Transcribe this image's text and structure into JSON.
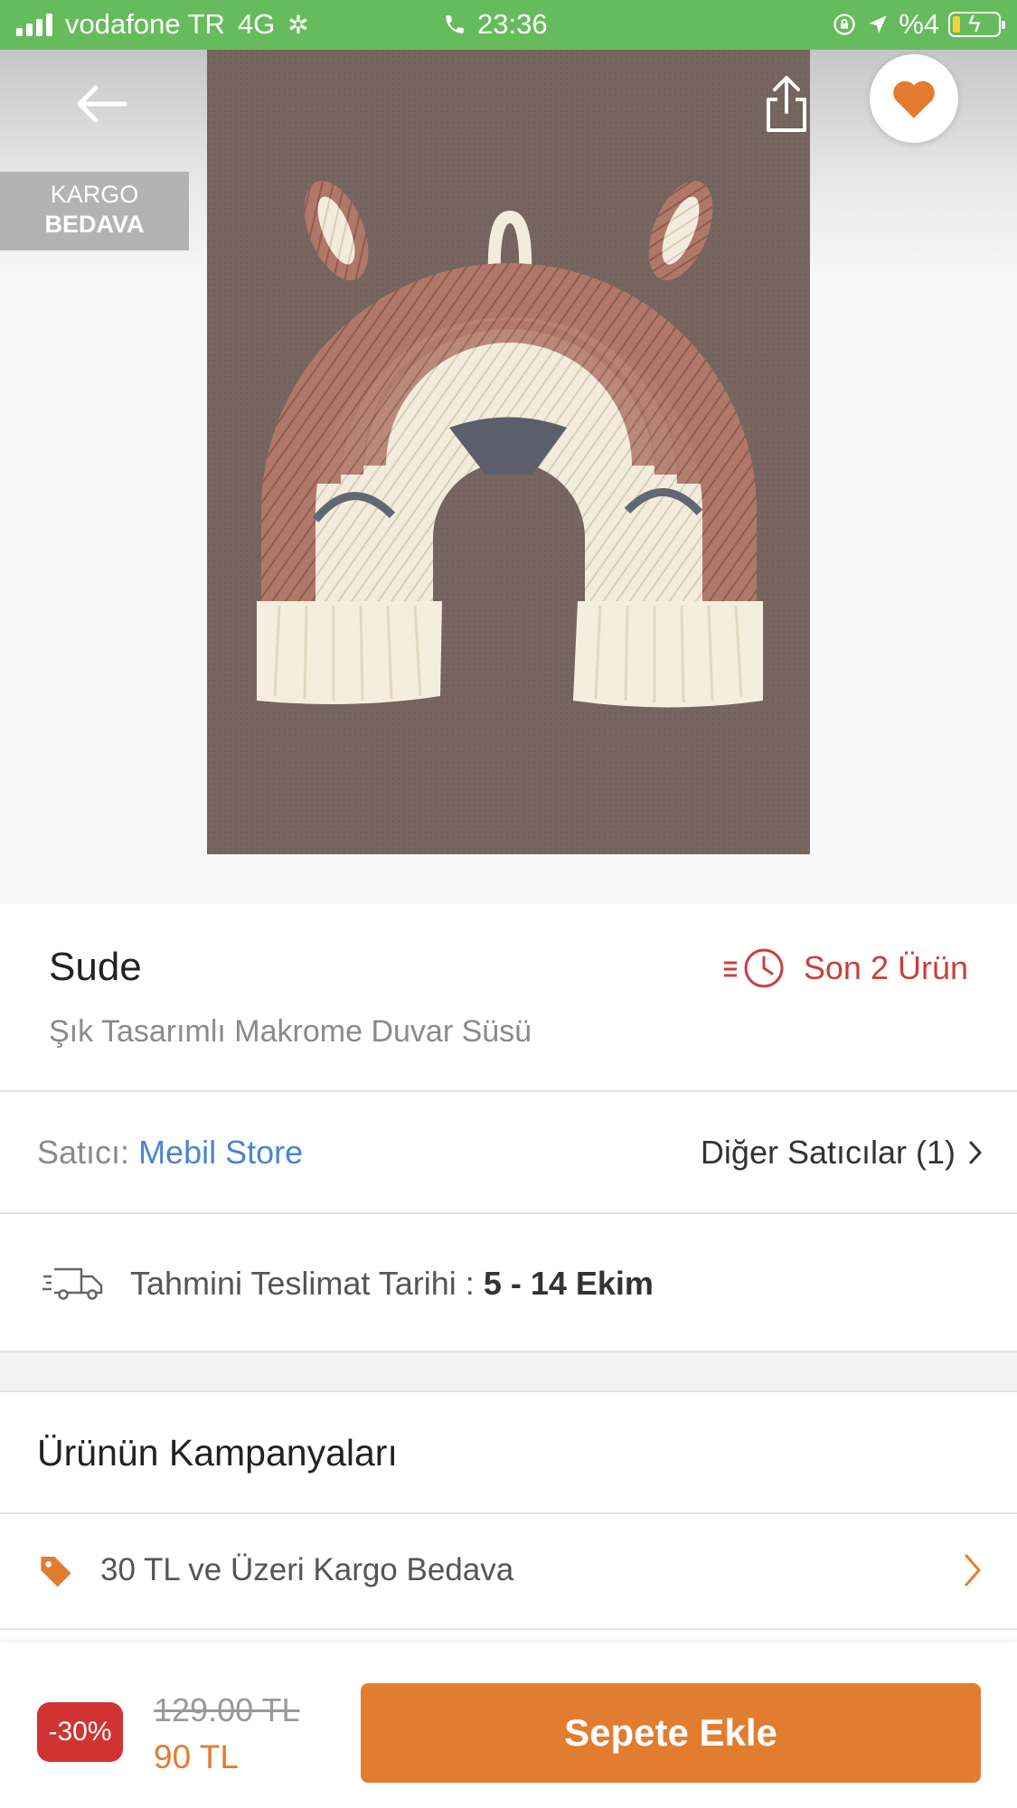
{
  "status_bar": {
    "carrier": "vodafone TR",
    "network": "4G",
    "time": "23:36",
    "battery": "%4"
  },
  "hero": {
    "badge_line1": "KARGO",
    "badge_line2": "BEDAVA",
    "icons": [
      "arrow-left-icon",
      "share-icon",
      "heart-icon"
    ]
  },
  "product": {
    "brand": "Sude",
    "title": "Şık Tasarımlı Makrome Duvar Süsü",
    "stock_text": "Son 2 Ürün"
  },
  "seller": {
    "label": "Satıcı:",
    "name": "Mebil Store",
    "others": "Diğer Satıcılar (1)"
  },
  "delivery": {
    "label": "Tahmini Teslimat Tarihi :",
    "dates": "5 - 14 Ekim"
  },
  "campaigns": {
    "heading": "Ürünün Kampanyaları",
    "items": [
      {
        "text": "30 TL ve Üzeri Kargo Bedava"
      }
    ]
  },
  "purchase": {
    "discount": "-30%",
    "old_price": "129.00 TL",
    "new_price": "90 TL",
    "button_label": "Sepete Ekle"
  },
  "colors": {
    "status_green": "#66bb5c",
    "accent_orange": "#e27d30",
    "link_blue": "#4a86cf",
    "alert_red": "#c8403a",
    "discount_red": "#cf3332"
  }
}
